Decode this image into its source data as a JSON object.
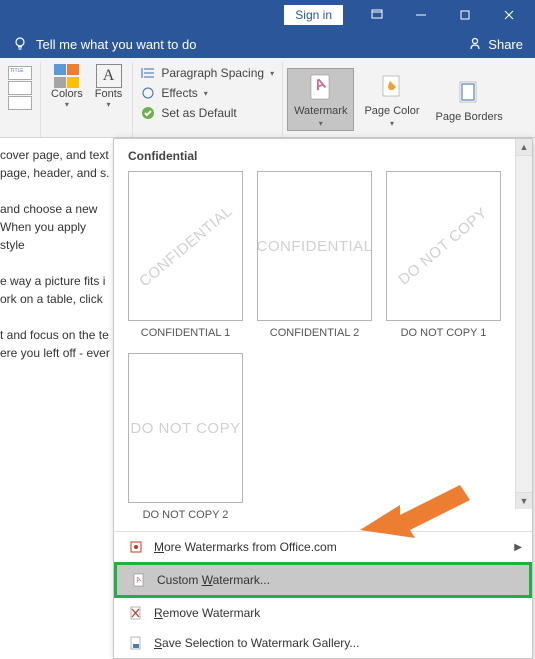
{
  "titlebar": {
    "signin": "Sign in"
  },
  "tellme": {
    "placeholder": "Tell me what you want to do",
    "share": "Share"
  },
  "ribbon": {
    "colors": "Colors",
    "fonts": "Fonts",
    "paragraph_spacing": "Paragraph Spacing",
    "effects": "Effects",
    "set_default": "Set as Default",
    "watermark": "Watermark",
    "page_color": "Page Color",
    "page_borders": "Page Borders"
  },
  "gallery": {
    "section": "Confidential",
    "items": [
      {
        "text": "CONFIDENTIAL",
        "label": "CONFIDENTIAL 1"
      },
      {
        "text": "CONFIDENTIAL",
        "label": "CONFIDENTIAL 2"
      },
      {
        "text": "DO NOT COPY",
        "label": "DO NOT COPY 1"
      },
      {
        "text": "DO NOT COPY",
        "label": "DO NOT COPY 2"
      }
    ]
  },
  "menu": {
    "more": "More Watermarks from Office.com",
    "custom": "Custom Watermark...",
    "remove": "Remove Watermark",
    "save": "Save Selection to Watermark Gallery..."
  },
  "doc": {
    "p1": "cover page, and text page, header, and s.",
    "p2": "and choose a new When you apply style",
    "p3": "e way a picture fits i ork on a table, click",
    "p4": "t and focus on the te ere you left off - ever"
  }
}
